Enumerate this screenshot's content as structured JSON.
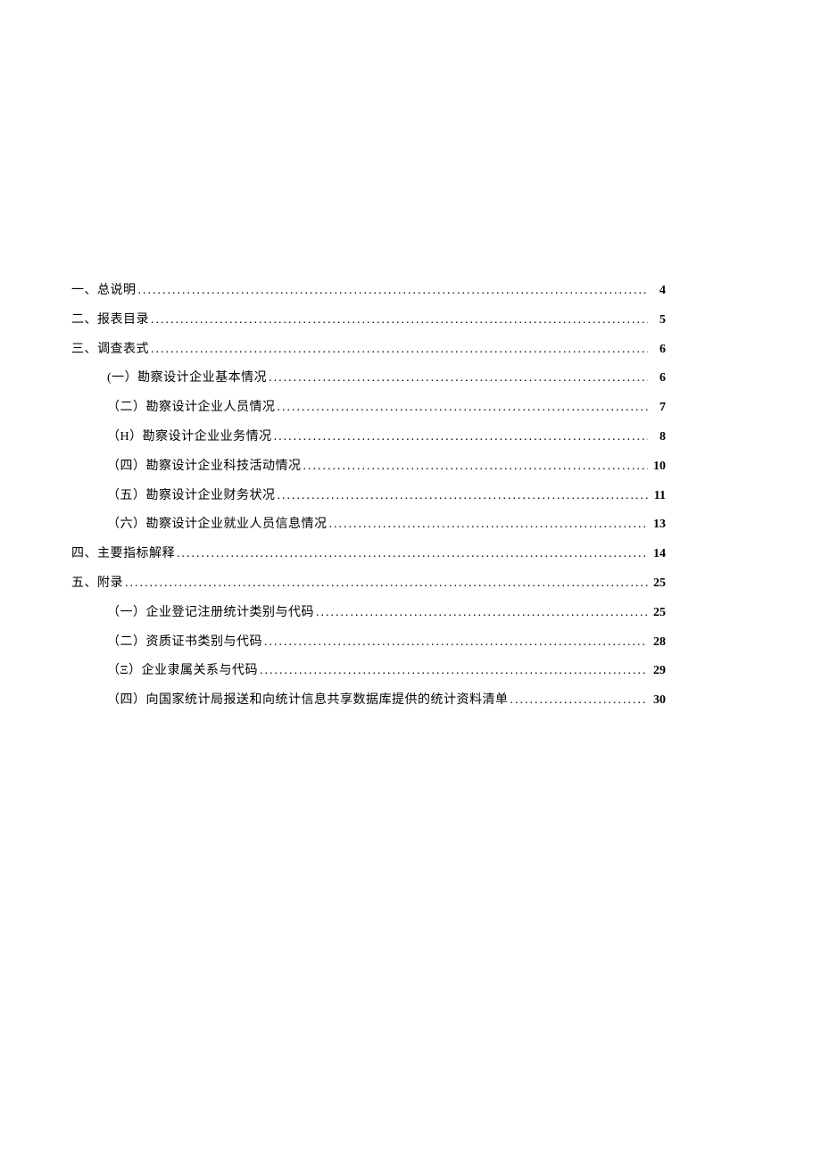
{
  "toc": [
    {
      "level": 1,
      "label": "一、总说明",
      "page": "4"
    },
    {
      "level": 1,
      "label": "二、报表目录",
      "page": "5"
    },
    {
      "level": 1,
      "label": "三、调查表式",
      "page": "6"
    },
    {
      "level": 2,
      "label": "(一）勘察设计企业基本情况",
      "page": "6"
    },
    {
      "level": 2,
      "label": "（二）勘察设计企业人员情况",
      "page": "7"
    },
    {
      "level": 2,
      "label": "（H）勘察设计企业业务情况",
      "page": "8",
      "boldMarker": true
    },
    {
      "level": 2,
      "label": "（四）勘察设计企业科技活动情况",
      "page": "10"
    },
    {
      "level": 2,
      "label": "（五）勘察设计企业财务状况",
      "page": "11"
    },
    {
      "level": 2,
      "label": "（六）勘察设计企业就业人员信息情况",
      "page": "13"
    },
    {
      "level": 1,
      "label": "四、主要指标解释",
      "page": "14"
    },
    {
      "level": 1,
      "label": "五、附录",
      "page": "25"
    },
    {
      "level": 2,
      "label": "（一）企业登记注册统计类别与代码",
      "page": "25"
    },
    {
      "level": 2,
      "label": "（二）资质证书类别与代码",
      "page": "28"
    },
    {
      "level": 2,
      "label": "（Ξ）企业隶属关系与代码",
      "page": "29",
      "boldMarker": true
    },
    {
      "level": 2,
      "label": "（四）向国家统计局报送和向统计信息共享数据库提供的统计资料清单",
      "page": "30"
    }
  ]
}
